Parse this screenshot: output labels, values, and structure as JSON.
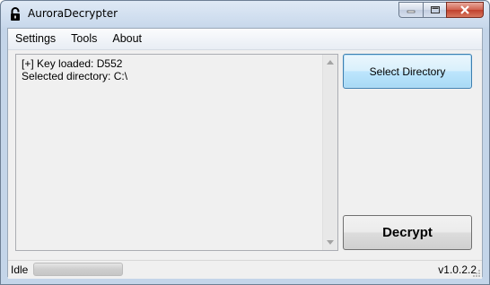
{
  "window": {
    "title": "AuroraDecrypter",
    "title_icon": "padlock-icon"
  },
  "menu": {
    "items": [
      "Settings",
      "Tools",
      "About"
    ]
  },
  "log": {
    "lines": [
      "[+] Key loaded: D552",
      "Selected directory: C:\\"
    ]
  },
  "buttons": {
    "select_directory": "Select Directory",
    "decrypt": "Decrypt"
  },
  "status": {
    "text": "Idle",
    "progress": 0,
    "version": "v1.0.2.2"
  },
  "colors": {
    "accent_button": "#bee6fd",
    "close_button": "#c0412d"
  }
}
